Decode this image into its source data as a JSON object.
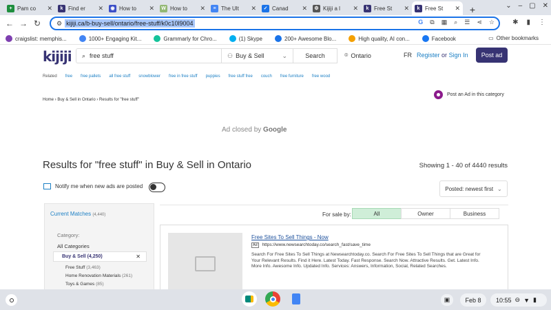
{
  "tabs": [
    {
      "label": "Pam co",
      "icon": "sheets-icon",
      "color": "#1e8e3e",
      "glyph": "+"
    },
    {
      "label": "Find er",
      "icon": "kijiji-icon",
      "color": "#373373",
      "glyph": "k"
    },
    {
      "label": "How to",
      "icon": "globe-icon",
      "color": "#3c4fc7",
      "glyph": "◉"
    },
    {
      "label": "How to",
      "icon": "wikihow-icon",
      "color": "#93b874",
      "glyph": "W"
    },
    {
      "label": "The Ult",
      "icon": "docs-icon",
      "color": "#4285f4",
      "glyph": "≡"
    },
    {
      "label": "Canad",
      "icon": "check-icon",
      "color": "#1a73e8",
      "glyph": "✓"
    },
    {
      "label": "Kijiji a l",
      "icon": "gear-icon",
      "color": "#555555",
      "glyph": "⚙"
    },
    {
      "label": "Free St",
      "icon": "kijiji-icon",
      "color": "#373373",
      "glyph": "k"
    },
    {
      "label": "Free St",
      "icon": "kijiji-icon",
      "color": "#373373",
      "glyph": "k"
    }
  ],
  "address": {
    "url": "kijiji.ca/b-buy-sell/ontario/free-stuff/k0c10l9004"
  },
  "bookmarks": [
    {
      "label": "craigslist: memphis...",
      "color": "#7e3fb0"
    },
    {
      "label": "1000+ Engaging Kit...",
      "color": "#4285f4"
    },
    {
      "label": "Grammarly for Chro...",
      "color": "#15c39a"
    },
    {
      "label": "(1) Skype",
      "color": "#00aff0"
    },
    {
      "label": "200+ Awesome Blo...",
      "color": "#1a73e8"
    },
    {
      "label": "High quality, AI con...",
      "color": "#f4a000"
    },
    {
      "label": "Facebook",
      "color": "#1877f2"
    }
  ],
  "bookmarks_other": "Other bookmarks",
  "header": {
    "logo": "kijiji",
    "search_value": "free stuff",
    "category": "Buy & Sell",
    "search_button": "Search",
    "location": "Ontario",
    "lang": "FR",
    "register": "Register",
    "or": "or",
    "signin": "Sign In",
    "post_ad": "Post ad"
  },
  "related": {
    "label": "Related",
    "links": [
      "free",
      "free pallets",
      "all free stuff",
      "snowblower",
      "free in free stuff",
      "puppies",
      "free stuff free",
      "couch",
      "free furniture",
      "free wood"
    ]
  },
  "breadcrumb": "Home › Buy & Sell in Ontario › Results for \"free stuff\"",
  "post_in_category": "Post an Ad in this category",
  "ad_closed": {
    "prefix": "Ad closed by",
    "brand": "Google"
  },
  "results": {
    "heading": "Results for \"free stuff\" in Buy & Sell in Ontario",
    "showing": "Showing 1 - 40 of 4440 results",
    "notify": "Notify me when new ads are posted",
    "sort": "Posted: newest first",
    "for_sale_by": "For sale by:",
    "segments": [
      "All",
      "Owner",
      "Business"
    ]
  },
  "sidebar": {
    "current_matches": "Current Matches",
    "count": "(4,440)",
    "category_label": "Category:",
    "all_categories": "All Categories",
    "selected": "Buy & Sell (4,250)",
    "subs": [
      {
        "name": "Free Stuff",
        "count": "(3,463)"
      },
      {
        "name": "Home Renovation Materials",
        "count": "(261)"
      },
      {
        "name": "Toys & Games",
        "count": "(85)"
      }
    ]
  },
  "ad_card": {
    "title": "Free Sites To Sell Things - Now",
    "ad_tag": "Ad",
    "url": "https://www.newsearchtoday.co/search_fast/save_time",
    "description": "Search For Free Sites To Sell Things at Newsearchtoday.co. Search For Free Sites To Sell Things that are Great for Your Relevant Results. Find it Here. Latest Today. Fast Response. Search Now. Attractive Results. Get. Latest Info. More Info. Awesome Info. Updated Info. Services: Answers, Information, Social, Related Searches."
  },
  "shelf": {
    "date": "Feb 8",
    "time": "10:55"
  }
}
